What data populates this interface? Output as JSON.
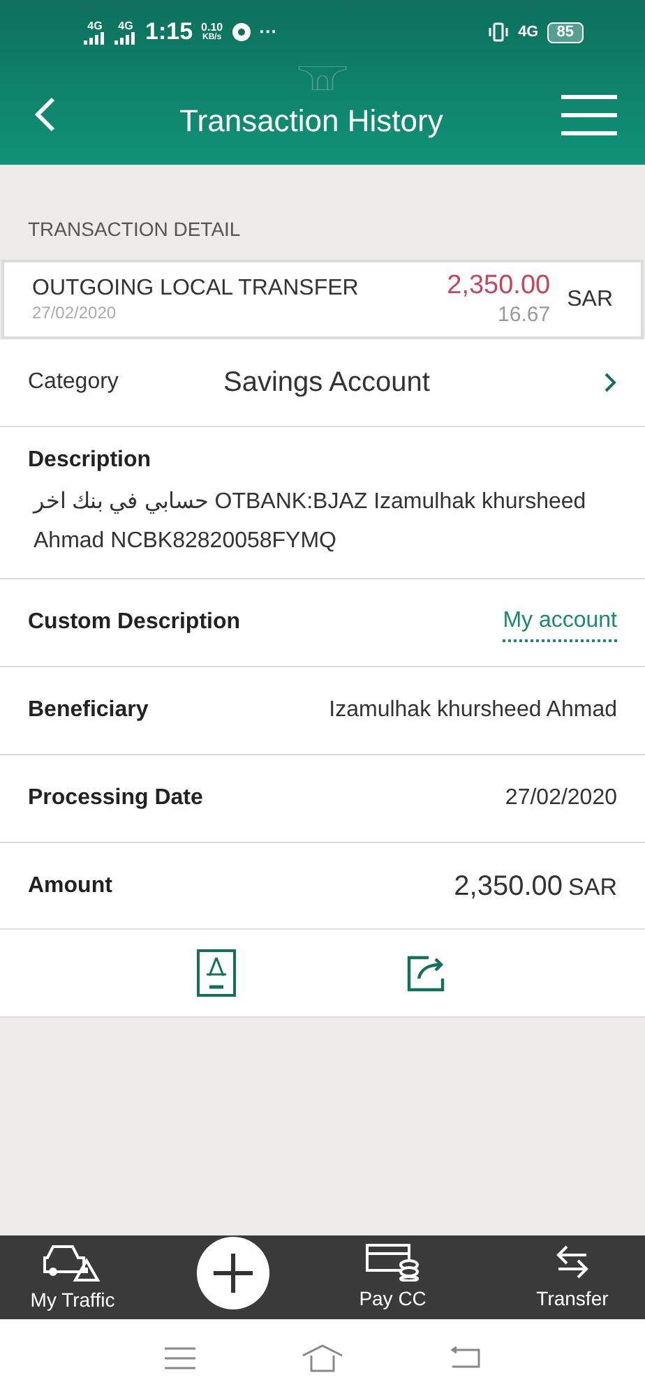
{
  "status_bar": {
    "network_1": "4G",
    "network_2": "4G",
    "time": "1:15",
    "speed": "0.10",
    "speed_unit": "KB/s",
    "more": "···",
    "network_3": "4G",
    "battery": "85"
  },
  "header": {
    "title": "Transaction History"
  },
  "section_title": "TRANSACTION DETAIL",
  "transaction": {
    "type": "OUTGOING LOCAL TRANSFER",
    "date": "27/02/2020",
    "amount": "2,350.00",
    "secondary_amount": "16.67",
    "currency": "SAR"
  },
  "details": [
    {
      "kind": "category",
      "label": "Category",
      "value": "Savings Account"
    },
    {
      "kind": "block",
      "label": "Description",
      "value": "حسابي في بنك اخر OTBANK:BJAZ Izamulhak khursheed Ahmad NCBK82820058FYMQ"
    },
    {
      "kind": "link",
      "label": "Custom Description",
      "value": "My account"
    },
    {
      "kind": "plain",
      "label": "Beneficiary",
      "value": "Izamulhak khursheed Ahmad"
    },
    {
      "kind": "plain",
      "label": "Processing Date",
      "value": "27/02/2020"
    },
    {
      "kind": "amount",
      "label": "Amount",
      "value": "2,350.00",
      "unit": "SAR"
    }
  ],
  "bottom_nav": [
    {
      "kind": "car",
      "label": "My Traffic"
    },
    {
      "kind": "add"
    },
    {
      "kind": "card",
      "label": "Pay CC"
    },
    {
      "kind": "transfer",
      "label": "Transfer"
    }
  ]
}
